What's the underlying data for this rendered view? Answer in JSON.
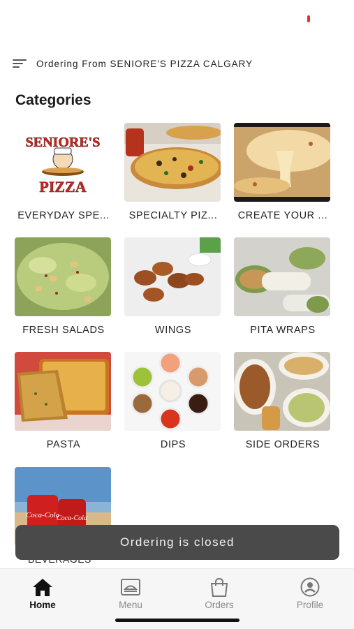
{
  "header": {
    "ordering_text": "Ordering From SENIORE'S PIZZA CALGARY",
    "menu_icon": "menu-lines-icon"
  },
  "categories_title": "Categories",
  "categories": [
    {
      "label": "EVERYDAY SPE...",
      "image": "seniores-pizza-logo"
    },
    {
      "label": "SPECIALTY PIZ...",
      "image": "specialty-pizza-photo"
    },
    {
      "label": "CREATE YOUR ...",
      "image": "cheese-pull-pizza-photo"
    },
    {
      "label": "FRESH SALADS",
      "image": "caesar-salad-photo"
    },
    {
      "label": "WINGS",
      "image": "chicken-wings-photo"
    },
    {
      "label": "PITA WRAPS",
      "image": "pita-wraps-photo"
    },
    {
      "label": "PASTA",
      "image": "lasagna-garlic-bread-photo"
    },
    {
      "label": "DIPS",
      "image": "dipping-sauces-photo"
    },
    {
      "label": "SIDE ORDERS",
      "image": "side-orders-platter-photo"
    },
    {
      "label": "BEVERAGES",
      "image": "coca-cola-cans-photo"
    }
  ],
  "logo": {
    "line1": "SENIORE'S",
    "line2": "PIZZA"
  },
  "beverages_brand": "Coca-Cola",
  "toast": {
    "message": "Ordering is closed"
  },
  "bottom_nav": [
    {
      "label": "Home",
      "icon": "home-icon",
      "active": true
    },
    {
      "label": "Menu",
      "icon": "menu-tray-icon",
      "active": false
    },
    {
      "label": "Orders",
      "icon": "shopping-bag-icon",
      "active": false
    },
    {
      "label": "Profile",
      "icon": "profile-icon",
      "active": false
    }
  ],
  "colors": {
    "toast_bg": "#4a4a4a",
    "nav_bg": "#f6f6f6",
    "brand_red": "#c8261e"
  }
}
